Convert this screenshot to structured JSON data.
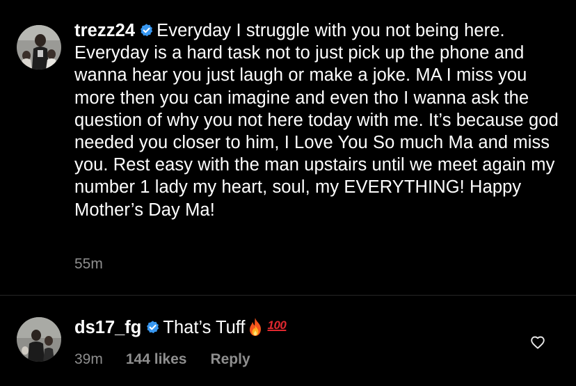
{
  "caption": {
    "username": "trezz24",
    "verified": true,
    "text": "Everyday I struggle with you not being here. Everyday is a hard task not to just pick up the phone and wanna hear you just laugh or make a joke. MA I miss you more then you can imagine and even tho I wanna ask the question of why you not here today with me. It’s because god needed you closer to him, I Love You So much Ma and miss you. Rest easy with the man upstairs until we meet again my number 1 lady my heart, soul, my EVERYTHING! Happy Mother’s Day Ma!",
    "time": "55m"
  },
  "comment": {
    "username": "ds17_fg",
    "verified": true,
    "text": "That’s Tuff",
    "emojis": [
      "fire-emoji",
      "hundred-points-emoji"
    ],
    "hundred_glyph": "100",
    "time": "39m",
    "likes": "144 likes",
    "reply_label": "Reply"
  },
  "icons": {
    "verified": "verified-badge-icon",
    "like": "heart-icon"
  },
  "colors": {
    "background": "#000000",
    "text": "#ffffff",
    "secondary_text": "#8e8e8e",
    "verified_badge": "#3897f0",
    "divider": "#262626"
  }
}
